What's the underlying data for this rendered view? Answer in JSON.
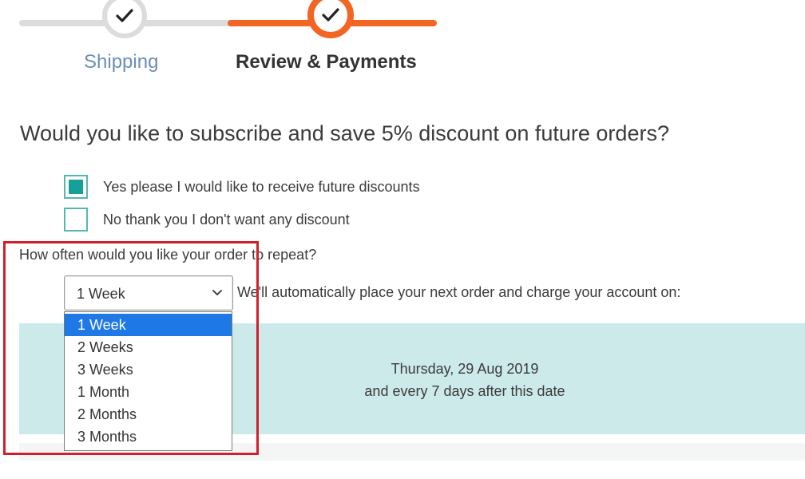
{
  "progress": {
    "steps": [
      {
        "label": "Shipping",
        "state": "completed",
        "icon": "check-icon"
      },
      {
        "label": "Review & Payments",
        "state": "current",
        "icon": "check-icon"
      }
    ],
    "colors": {
      "completed_track": "#dcdcdc",
      "current_track": "#f26522",
      "completed_label": "#6b8fb4"
    }
  },
  "subscribe": {
    "question": "Would you like to subscribe and save 5% discount on future orders?",
    "options": [
      {
        "label": "Yes please I would like to receive future discounts",
        "checked": true
      },
      {
        "label": "No thank you I don't want any discount",
        "checked": false
      }
    ],
    "checkbox_color": "#16a09a"
  },
  "repeat": {
    "label": "How often would you like your order to repeat?",
    "selected": "1 Week",
    "options": [
      "1 Week",
      "2 Weeks",
      "3 Weeks",
      "1 Month",
      "2 Months",
      "3 Months"
    ],
    "highlighted_option": "1 Week",
    "dropdown_open": true
  },
  "schedule": {
    "note": "We'll automatically place your next order and charge your account on:",
    "date": "Thursday, 29 Aug 2019",
    "recurrence": "and every 7 days after this date",
    "box_color": "#cdeaea"
  },
  "annotation": {
    "frame_color": "#d21f2b"
  }
}
